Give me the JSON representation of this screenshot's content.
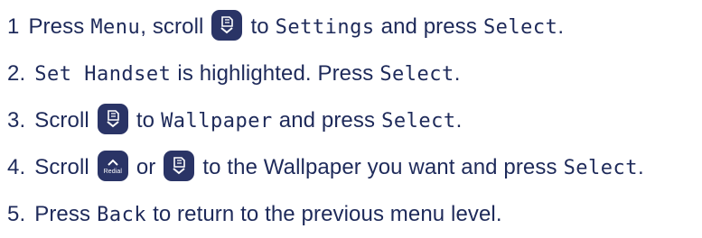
{
  "colors": {
    "text": "#1e2a5a",
    "key_background": "#2a3466"
  },
  "icons": {
    "scroll_down": "phonebook-down-arrow-icon",
    "redial": "redial-up-arrow-icon"
  },
  "steps": [
    {
      "number": "1",
      "t1": "Press",
      "k1": "Menu",
      "t2": ", scroll",
      "t3": "to",
      "k2": "Settings",
      "t4": "and press",
      "k3": "Select",
      "t5": "."
    },
    {
      "number": "2.",
      "k1": "Set Handset",
      "t1": "is highlighted. Press",
      "k2": "Select",
      "t2": "."
    },
    {
      "number": "3.",
      "t1": "Scroll",
      "t2": "to",
      "k1": "Wallpaper",
      "t3": "and press",
      "k2": "Select",
      "t4": "."
    },
    {
      "number": "4.",
      "t1": "Scroll",
      "redial_label": "Redial",
      "t2": "or",
      "t3": "to the Wallpaper you want and press",
      "k1": "Select",
      "t4": "."
    },
    {
      "number": "5.",
      "t1": "Press",
      "k1": "Back",
      "t2": "to return to the previous menu level."
    }
  ]
}
